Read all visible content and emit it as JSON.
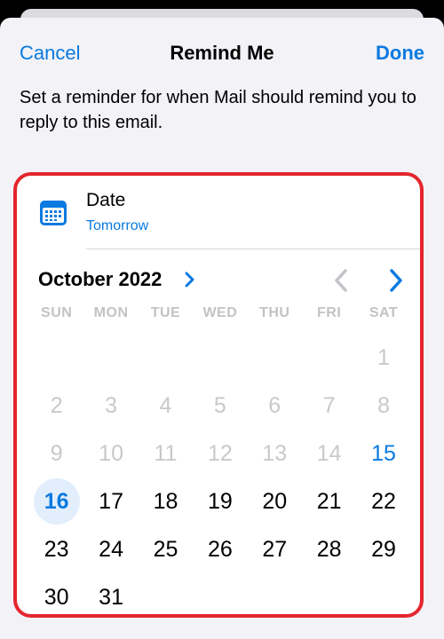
{
  "nav": {
    "cancel": "Cancel",
    "title": "Remind Me",
    "done": "Done"
  },
  "description": "Set a reminder for when Mail should remind you to reply to this email.",
  "date_row": {
    "label": "Date",
    "value": "Tomorrow"
  },
  "calendar": {
    "month_label": "October 2022",
    "weekdays": [
      "SUN",
      "MON",
      "TUE",
      "WED",
      "THU",
      "FRI",
      "SAT"
    ],
    "leading_blanks": 6,
    "days": [
      {
        "n": "1",
        "state": "disabled"
      },
      {
        "n": "2",
        "state": "disabled"
      },
      {
        "n": "3",
        "state": "disabled"
      },
      {
        "n": "4",
        "state": "disabled"
      },
      {
        "n": "5",
        "state": "disabled"
      },
      {
        "n": "6",
        "state": "disabled"
      },
      {
        "n": "7",
        "state": "disabled"
      },
      {
        "n": "8",
        "state": "disabled"
      },
      {
        "n": "9",
        "state": "disabled"
      },
      {
        "n": "10",
        "state": "disabled"
      },
      {
        "n": "11",
        "state": "disabled"
      },
      {
        "n": "12",
        "state": "disabled"
      },
      {
        "n": "13",
        "state": "disabled"
      },
      {
        "n": "14",
        "state": "disabled"
      },
      {
        "n": "15",
        "state": "today"
      },
      {
        "n": "16",
        "state": "selected"
      },
      {
        "n": "17",
        "state": "normal"
      },
      {
        "n": "18",
        "state": "normal"
      },
      {
        "n": "19",
        "state": "normal"
      },
      {
        "n": "20",
        "state": "normal"
      },
      {
        "n": "21",
        "state": "normal"
      },
      {
        "n": "22",
        "state": "normal"
      },
      {
        "n": "23",
        "state": "normal"
      },
      {
        "n": "24",
        "state": "normal"
      },
      {
        "n": "25",
        "state": "normal"
      },
      {
        "n": "26",
        "state": "normal"
      },
      {
        "n": "27",
        "state": "normal"
      },
      {
        "n": "28",
        "state": "normal"
      },
      {
        "n": "29",
        "state": "normal"
      },
      {
        "n": "30",
        "state": "normal"
      },
      {
        "n": "31",
        "state": "normal"
      }
    ]
  },
  "colors": {
    "accent": "#0a7ae0",
    "highlight_border": "#e4252d",
    "selected_bg": "#e2eefc"
  }
}
